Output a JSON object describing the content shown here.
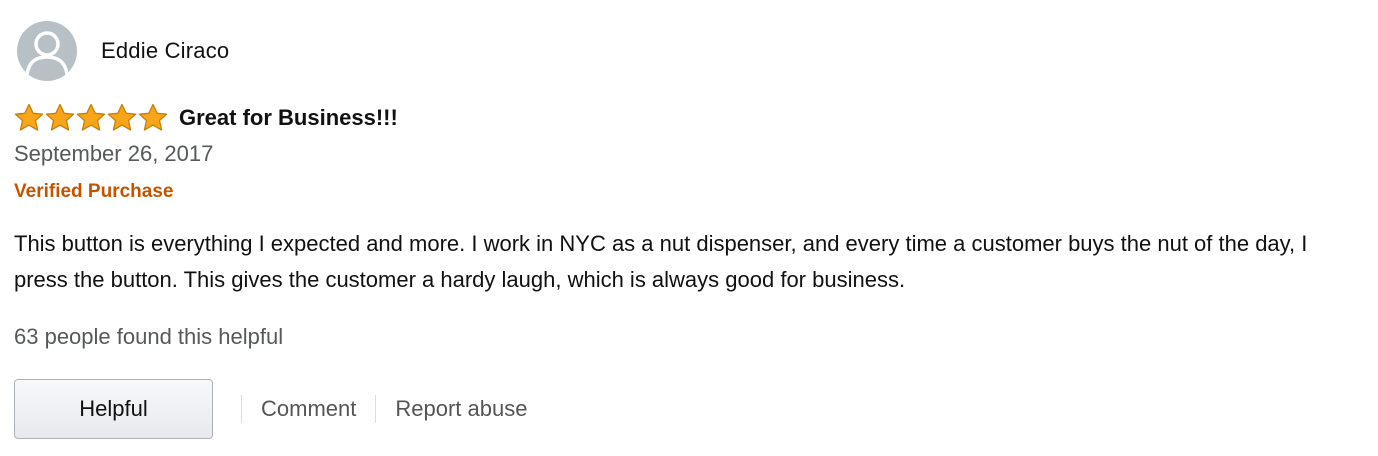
{
  "reviewer": {
    "name": "Eddie Ciraco",
    "avatar_icon": "default-user-avatar-icon",
    "avatar_color": "#b7c0c5"
  },
  "review": {
    "rating": 5,
    "rating_max": 5,
    "star_icon": "star-icon",
    "star_color": "#f8a619",
    "title": "Great for Business!!!",
    "date": "September 26, 2017",
    "verified_label": "Verified Purchase",
    "verified_color": "#c45500",
    "body": "This button is everything I expected and more. I work in NYC as a nut dispenser, and every time a customer buys the nut of the day, I press the button. This gives the customer a hardy laugh, which is always good for business."
  },
  "helpful_count_text": "63 people found this helpful",
  "actions": {
    "helpful_label": "Helpful",
    "comment_label": "Comment",
    "report_label": "Report abuse"
  }
}
